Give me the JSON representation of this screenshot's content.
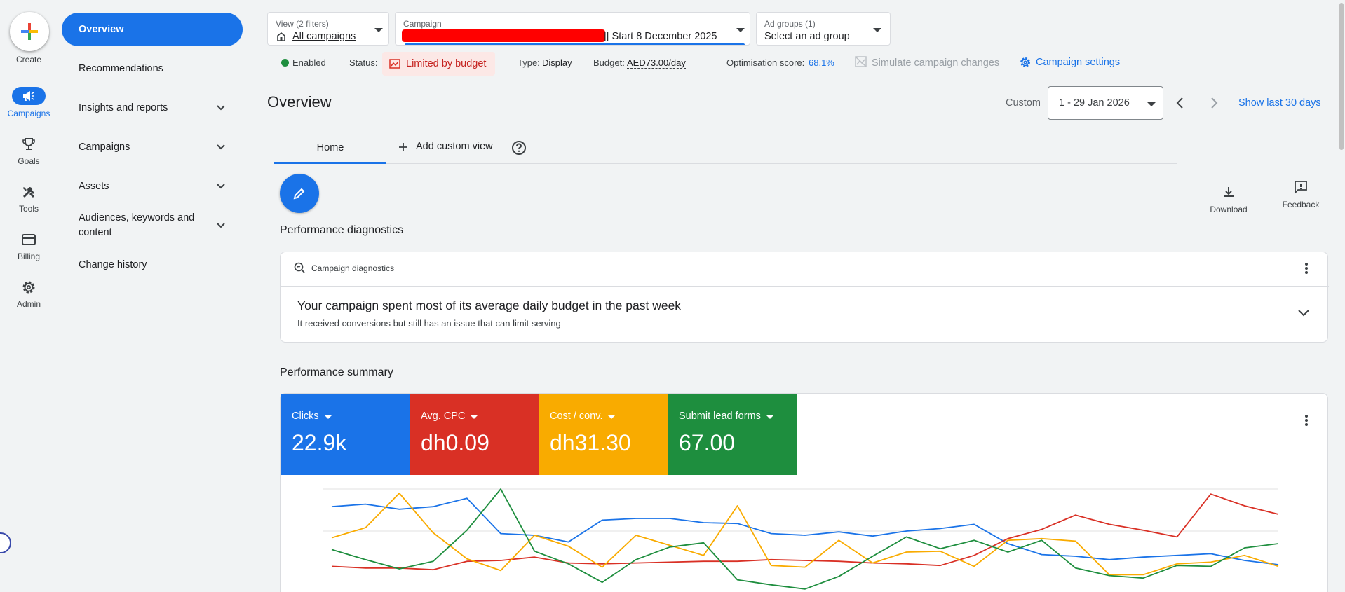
{
  "rail": {
    "create_label": "Create",
    "items": [
      {
        "label": "Campaigns",
        "icon": "megaphone-icon"
      },
      {
        "label": "Goals",
        "icon": "trophy-icon"
      },
      {
        "label": "Tools",
        "icon": "tools-icon"
      },
      {
        "label": "Billing",
        "icon": "credit-card-icon"
      },
      {
        "label": "Admin",
        "icon": "gear-icon"
      }
    ]
  },
  "nav": {
    "items": [
      {
        "label": "Overview"
      },
      {
        "label": "Recommendations"
      },
      {
        "label": "Insights and reports"
      },
      {
        "label": "Campaigns"
      },
      {
        "label": "Assets"
      },
      {
        "label": "Audiences, keywords and content"
      },
      {
        "label": "Change history"
      }
    ]
  },
  "filters": {
    "view_label": "View (2 filters)",
    "view_value": "All campaigns",
    "campaign_label": "Campaign",
    "campaign_value": "|| Start 8 December 2025",
    "adgroups_label": "Ad groups (1)",
    "adgroups_value": "Select an ad group"
  },
  "status": {
    "enabled": "Enabled",
    "status_label": "Status:",
    "status_value": "Limited by budget",
    "type_label": "Type:",
    "type_value": "Display",
    "budget_label": "Budget:",
    "budget_value": "AED73.00/day",
    "opt_label": "Optimisation score:",
    "opt_value": "68.1%",
    "simulate": "Simulate campaign changes",
    "settings": "Campaign settings"
  },
  "page": {
    "title": "Overview",
    "date_mode": "Custom",
    "date_range": "1 - 29 Jan 2026",
    "show_last": "Show last 30 days"
  },
  "tabs": {
    "home": "Home",
    "add_view": "Add custom view"
  },
  "actions": {
    "download": "Download",
    "feedback": "Feedback"
  },
  "diagnostics": {
    "section_title": "Performance diagnostics",
    "card_title": "Campaign diagnostics",
    "headline": "Your campaign spent most of its average daily budget in the past week",
    "subline": "It received conversions but still has an issue that can limit serving"
  },
  "summary": {
    "section_title": "Performance summary",
    "metrics": [
      {
        "label": "Clicks",
        "value": "22.9k",
        "color": "#1a73e8"
      },
      {
        "label": "Avg. CPC",
        "value": "dh0.09",
        "color": "#d93025"
      },
      {
        "label": "Cost / conv.",
        "value": "dh31.30",
        "color": "#f9ab00"
      },
      {
        "label": "Submit lead forms",
        "value": "67.00",
        "color": "#1e8e3e"
      }
    ]
  },
  "chart_data": {
    "type": "line",
    "x": [
      1,
      2,
      3,
      4,
      5,
      6,
      7,
      8,
      9,
      10,
      11,
      12,
      13,
      14,
      15,
      16,
      17,
      18,
      19,
      20,
      21,
      22,
      23,
      24,
      25,
      26,
      27,
      28,
      29
    ],
    "ylim": [
      0,
      100
    ],
    "grid": true,
    "series": [
      {
        "color": "#1a73e8",
        "values": [
          79,
          82,
          76,
          79,
          89,
          47,
          45,
          37,
          63,
          65,
          65,
          60,
          59,
          47,
          45,
          49,
          44,
          50,
          53,
          58,
          35,
          22,
          20,
          16,
          19,
          21,
          23,
          15,
          10
        ]
      },
      {
        "color": "#d93025",
        "values": [
          8,
          6,
          6,
          4,
          14,
          15,
          19,
          12,
          11,
          12,
          13,
          14,
          14,
          16,
          15,
          14,
          12,
          11,
          9,
          21,
          41,
          52,
          69,
          58,
          51,
          43,
          94,
          80,
          70
        ]
      },
      {
        "color": "#f9ab00",
        "values": [
          42,
          54,
          95,
          48,
          17,
          3,
          45,
          32,
          7,
          45,
          33,
          21,
          80,
          9,
          7,
          39,
          12,
          25,
          26,
          8,
          39,
          41,
          38,
          -2,
          -2,
          11,
          13,
          21,
          8
        ]
      },
      {
        "color": "#1e8e3e",
        "values": [
          28,
          16,
          5,
          14,
          51,
          100,
          26,
          11,
          -11,
          16,
          31,
          36,
          -8,
          -14,
          -19,
          -4,
          20,
          43,
          29,
          39,
          25,
          39,
          6,
          -3,
          -6,
          9,
          8,
          30,
          35
        ]
      }
    ]
  }
}
